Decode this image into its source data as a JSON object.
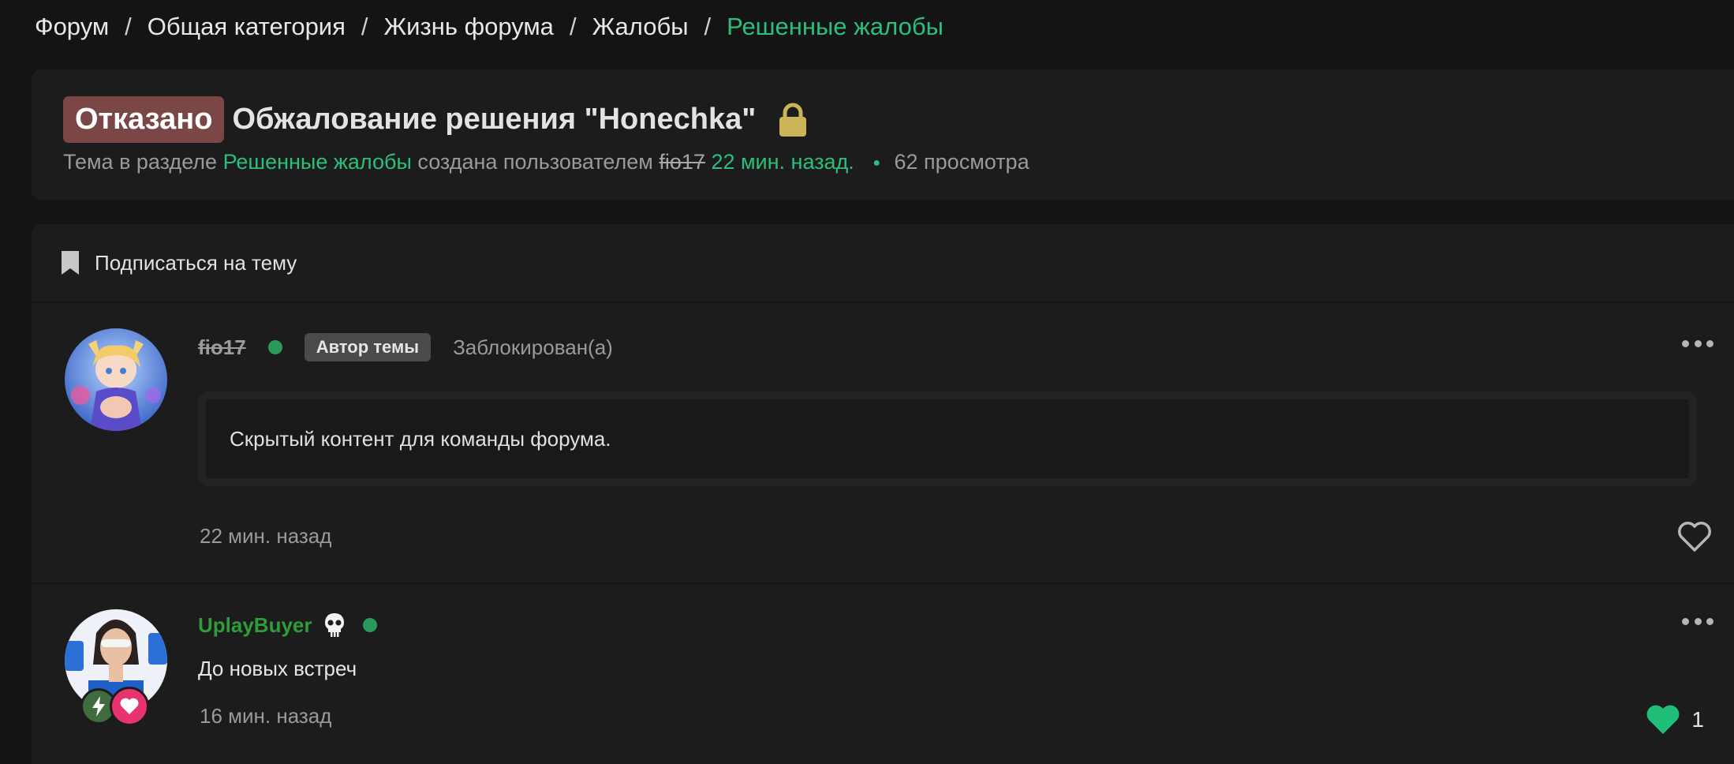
{
  "breadcrumb": {
    "items": [
      "Форум",
      "Общая категория",
      "Жизнь форума",
      "Жалобы"
    ],
    "current": "Решенные жалобы",
    "separator": "/"
  },
  "thread": {
    "status": "Отказано",
    "title": "Обжалование решения \"Honechka\"",
    "meta_prefix": "Тема в разделе",
    "section": "Решенные жалобы",
    "created_by": "создана пользователем",
    "author": "fio17",
    "time": "22 мин. назад.",
    "views": "62 просмотра"
  },
  "subscribe": {
    "label": "Подписаться на тему"
  },
  "posts": [
    {
      "username": "fio17",
      "role": "Автор темы",
      "status": "Заблокирован(а)",
      "hidden_text": "Скрытый контент для команды форума.",
      "time": "22 мин. назад"
    },
    {
      "username": "UplayBuyer",
      "body": "До новых встреч",
      "time": "16 мин. назад",
      "likes": "1"
    }
  ],
  "colors": {
    "accent": "#2bbf7e",
    "status_badge": "#7a4646",
    "lock": "#c9b458",
    "like_filled": "#1fbf7a"
  }
}
